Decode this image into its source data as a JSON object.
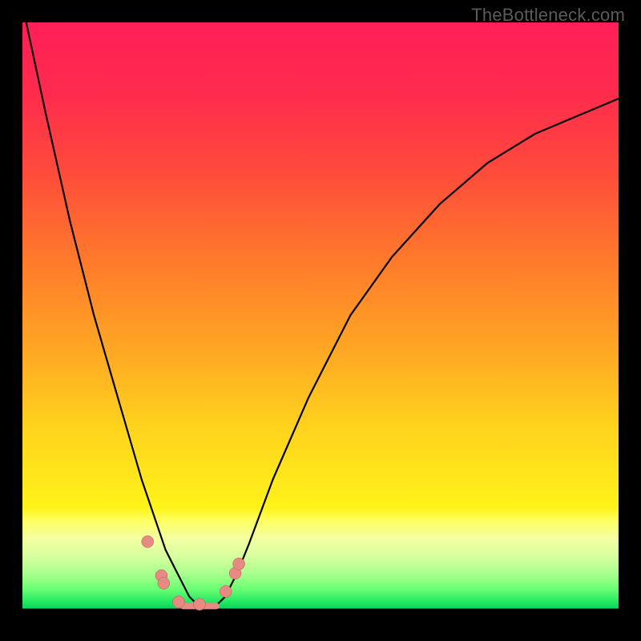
{
  "watermark": "TheBottleneck.com",
  "chart_data": {
    "type": "line",
    "title": "",
    "xlabel": "",
    "ylabel": "",
    "x": [
      0.0,
      0.04,
      0.08,
      0.12,
      0.16,
      0.2,
      0.22,
      0.24,
      0.26,
      0.28,
      0.3,
      0.32,
      0.34,
      0.36,
      0.38,
      0.42,
      0.48,
      0.55,
      0.62,
      0.7,
      0.78,
      0.86,
      0.93,
      1.0
    ],
    "y": [
      1.03,
      0.84,
      0.66,
      0.5,
      0.36,
      0.22,
      0.16,
      0.1,
      0.06,
      0.02,
      0.0,
      0.0,
      0.02,
      0.06,
      0.11,
      0.22,
      0.36,
      0.5,
      0.6,
      0.69,
      0.76,
      0.81,
      0.84,
      0.87
    ],
    "ylim": [
      0,
      1
    ],
    "xlim": [
      0,
      1
    ],
    "markers": {
      "x": [
        0.21,
        0.233,
        0.237,
        0.262,
        0.297,
        0.341,
        0.357,
        0.363
      ],
      "y": [
        0.114,
        0.056,
        0.043,
        0.011,
        0.007,
        0.029,
        0.06,
        0.076
      ]
    },
    "flat_segment": {
      "x_start": 0.27,
      "x_end": 0.325,
      "y": 0.004
    },
    "gradient_stops": [
      "#ff1f57",
      "#ff7a2b",
      "#ffe81b",
      "#22e862"
    ],
    "legend": []
  }
}
